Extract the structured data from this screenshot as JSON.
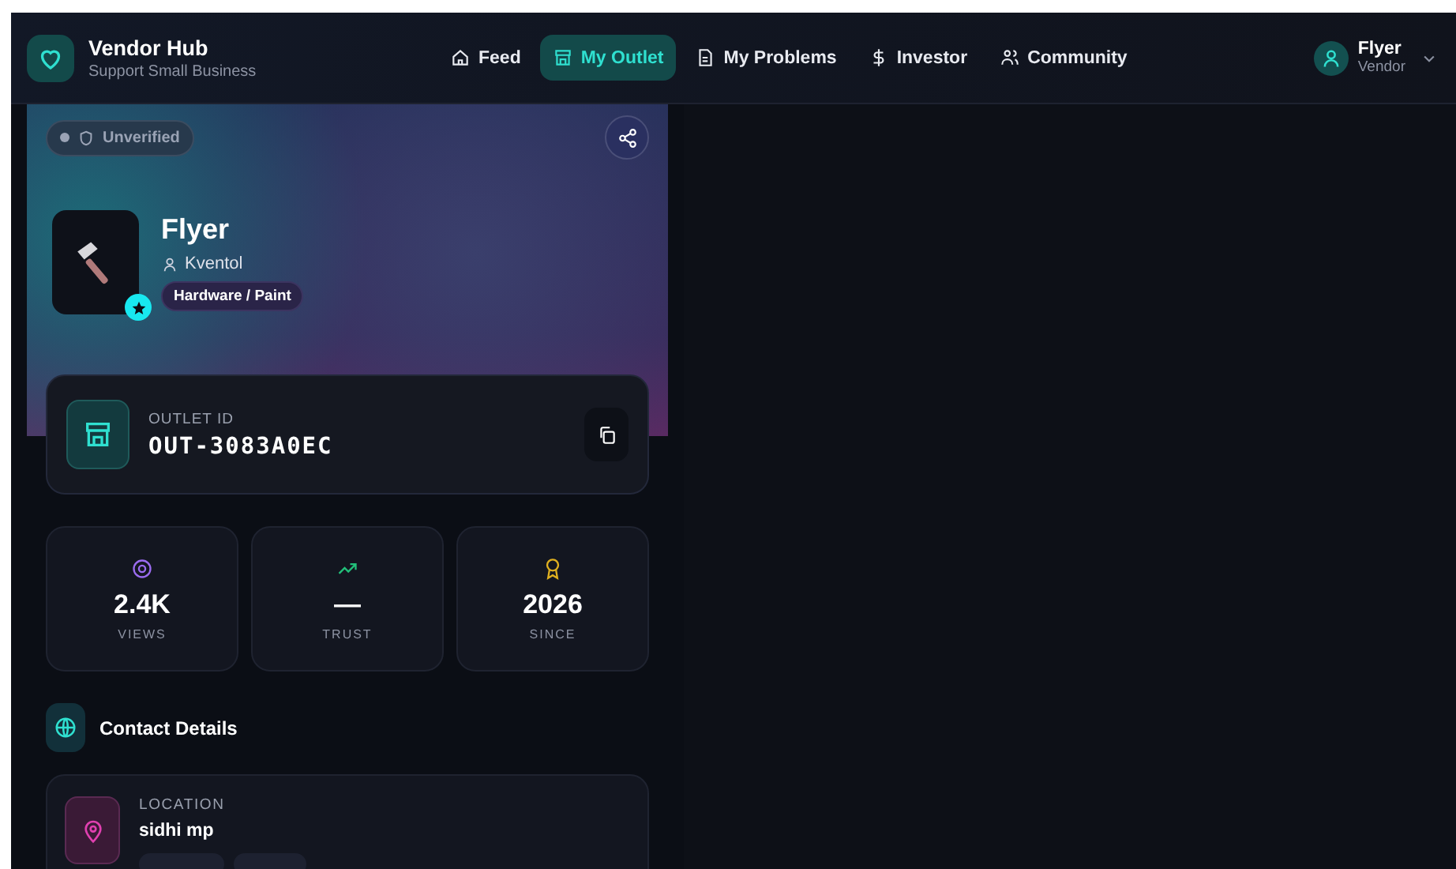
{
  "brand": {
    "name": "Vendor Hub",
    "tagline": "Support Small Business"
  },
  "nav": [
    {
      "label": "Feed",
      "selected": false
    },
    {
      "label": "My Outlet",
      "selected": true
    },
    {
      "label": "My Problems",
      "selected": false
    },
    {
      "label": "Investor",
      "selected": false
    },
    {
      "label": "Community",
      "selected": false
    }
  ],
  "user": {
    "name": "Flyer",
    "role": "Vendor"
  },
  "outlet": {
    "status": "Unverified",
    "verified": false,
    "name": "Flyer",
    "owner": "Kventol",
    "category": "Hardware / Paint",
    "id_label": "OUTLET ID",
    "id": "OUT-3083A0EC"
  },
  "stats": [
    {
      "kind": "views",
      "value": "2.4K",
      "label": "VIEWS"
    },
    {
      "kind": "trust",
      "value": "—",
      "label": "TRUST"
    },
    {
      "kind": "since",
      "value": "2026",
      "label": "SINCE"
    }
  ],
  "contact": {
    "title": "Contact Details",
    "items": [
      {
        "kind": "location",
        "label": "LOCATION",
        "value": "sidhi mp"
      }
    ]
  }
}
